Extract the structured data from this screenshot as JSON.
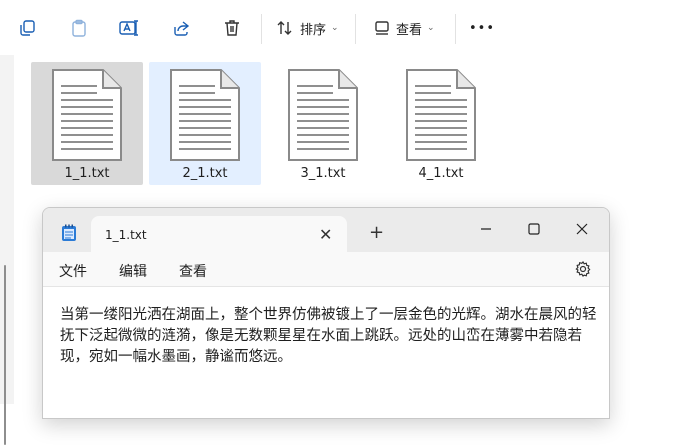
{
  "toolbar": {
    "sort_label": "排序",
    "view_label": "查看",
    "more_label": "•••"
  },
  "files": [
    {
      "name": "1_1.txt"
    },
    {
      "name": "2_1.txt"
    },
    {
      "name": "3_1.txt"
    },
    {
      "name": "4_1.txt"
    }
  ],
  "notepad": {
    "tab_title": "1_1.txt",
    "close_tab": "✕",
    "new_tab": "+",
    "menu": {
      "file": "文件",
      "edit": "编辑",
      "view": "查看"
    },
    "content": "当第一缕阳光洒在湖面上，整个世界仿佛被镀上了一层金色的光辉。湖水在晨风的轻抚下泛起微微的涟漪，像是无数颗星星在水面上跳跃。远处的山峦在薄雾中若隐若现，宛如一幅水墨画，静谧而悠远。"
  },
  "colors": {
    "accent": "#1a5fb4",
    "selected_grey": "#d9d9d9",
    "selected_blue": "#e3efff"
  }
}
